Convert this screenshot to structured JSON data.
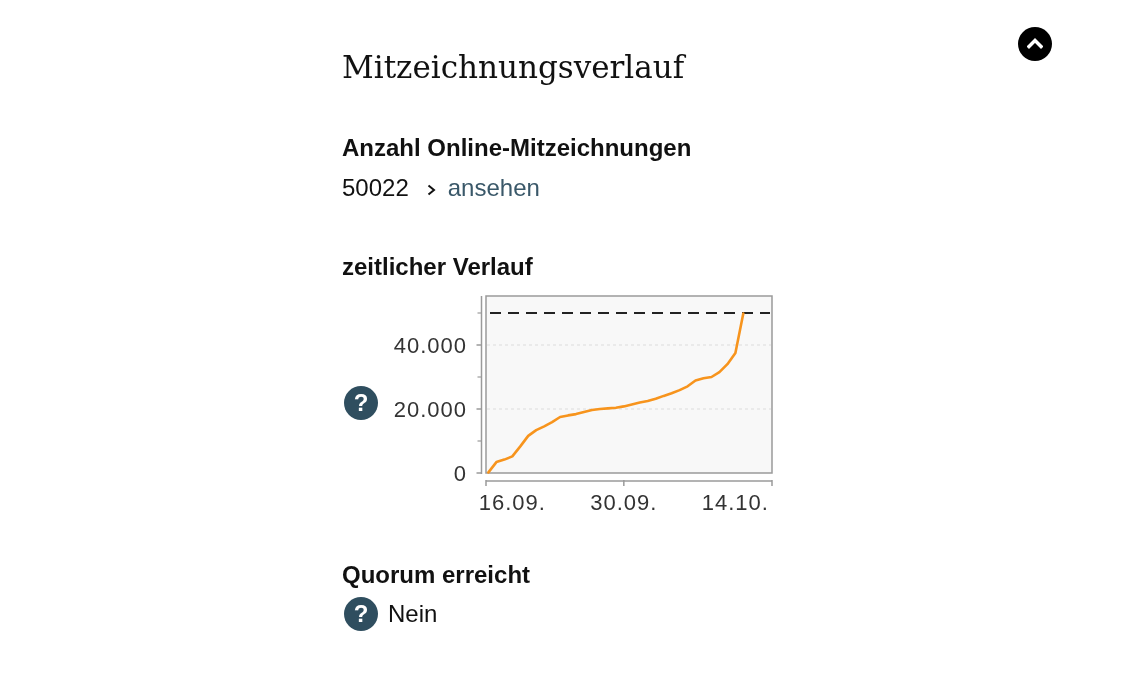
{
  "title": "Mitzeichnungsverlauf",
  "sections": [
    {
      "kind": "count",
      "heading": "Anzahl Online-Mitzeichnungen",
      "value": "50022",
      "link": "ansehen"
    },
    {
      "kind": "chart",
      "heading": "zeitlicher Verlauf",
      "help_mark": "?",
      "chart_data": {
        "type": "line",
        "categories": [
          null,
          null,
          null,
          "16.09.",
          null,
          null,
          null,
          null,
          null,
          null,
          null,
          null,
          null,
          null,
          null,
          null,
          null,
          "30.09.",
          null,
          null,
          null,
          null,
          null,
          null,
          null,
          null,
          null,
          null,
          null,
          null,
          null,
          "14.10.",
          null,
          null,
          null,
          null
        ],
        "series": [
          {
            "color": "#f7941d",
            "values": [
              200,
              3400,
              4200,
              5200,
              8300,
              11600,
              13400,
              14600,
              15900,
              17500,
              18000,
              18400,
              19100,
              19700,
              20000,
              20200,
              20400,
              20800,
              21400,
              22000,
              22500,
              23200,
              24100,
              24900,
              25900,
              27100,
              28900,
              29600,
              30000,
              31500,
              34000,
              37500,
              49800,
              null,
              null,
              null
            ]
          }
        ],
        "ylim": [
          0,
          55000
        ],
        "yticks": [
          {
            "value": 0,
            "label": "0"
          },
          {
            "value": 20000,
            "label": "20.000"
          },
          {
            "value": 40000,
            "label": "40.000"
          }
        ],
        "ref_lines": [
          {
            "axis": "y",
            "value": 50000
          }
        ]
      }
    },
    {
      "kind": "status",
      "heading": "Quorum erreicht",
      "help_mark": "?",
      "value": "Nein"
    }
  ]
}
